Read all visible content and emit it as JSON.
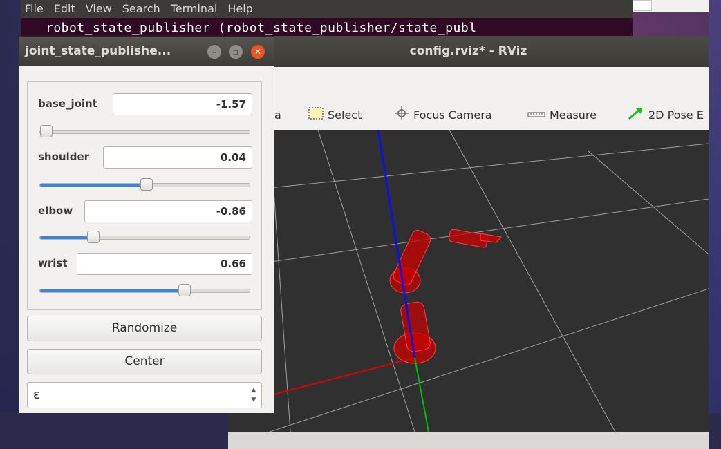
{
  "terminal": {
    "menu": [
      "File",
      "Edit",
      "View",
      "Search",
      "Terminal",
      "Help"
    ],
    "line": "robot_state_publisher (robot_state_publisher/state_publ"
  },
  "rviz": {
    "title": "config.rviz* - RViz",
    "toolbar": {
      "partial_label": "a",
      "select": "Select",
      "focus_camera": "Focus Camera",
      "measure": "Measure",
      "pose_estimate": "2D Pose E"
    },
    "axis_colors": {
      "x": "#e00000",
      "y": "#00c000",
      "z": "#1010e0"
    },
    "robot_color": "#cc0000",
    "grid_color": "#a0a0a0"
  },
  "jsp": {
    "title": "joint_state_publishe...",
    "joints": [
      {
        "name": "base_joint",
        "value": "-1.57",
        "level": 0.0
      },
      {
        "name": "shoulder",
        "value": "0.04",
        "level": 0.51
      },
      {
        "name": "elbow",
        "value": "-0.86",
        "level": 0.24
      },
      {
        "name": "wrist",
        "value": "0.66",
        "level": 0.7
      }
    ],
    "buttons": {
      "randomize": "Randomize",
      "center": "Center"
    },
    "combo_value": "ε"
  }
}
